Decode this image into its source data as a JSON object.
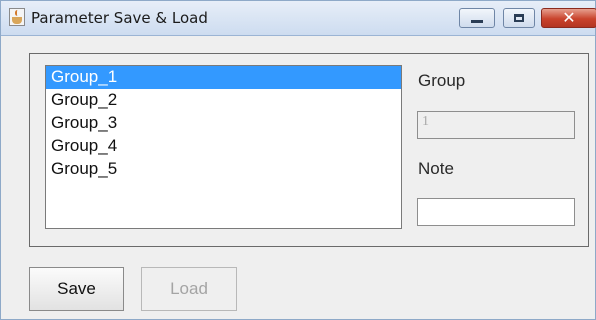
{
  "window": {
    "title": "Parameter Save & Load"
  },
  "list": {
    "items": [
      "Group_1",
      "Group_2",
      "Group_3",
      "Group_4",
      "Group_5"
    ],
    "selected_index": 0
  },
  "form": {
    "group_label": "Group",
    "group_value": "1",
    "note_label": "Note",
    "note_value": ""
  },
  "buttons": {
    "save_label": "Save",
    "load_label": "Load"
  },
  "colors": {
    "selection": "#3399ff",
    "close_button": "#c9432c"
  }
}
